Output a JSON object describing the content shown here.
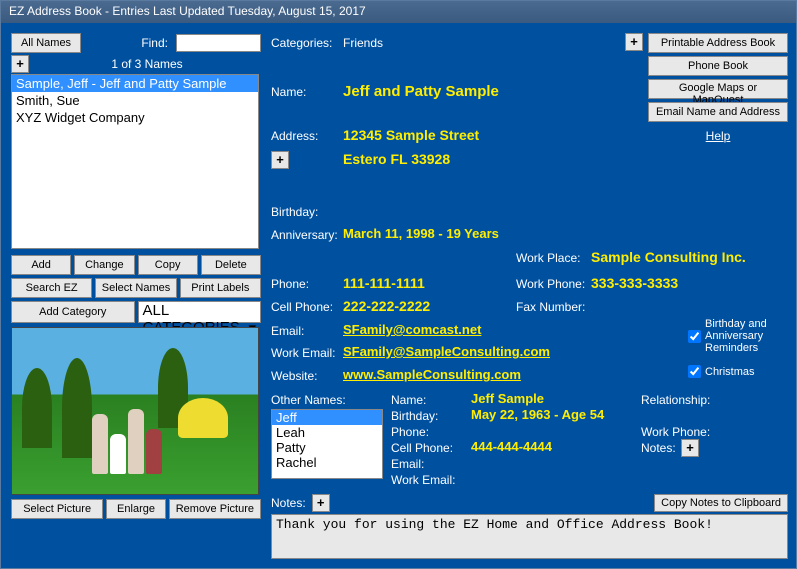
{
  "window": {
    "title": "EZ Address Book - Entries Last Updated Tuesday, August 15, 2017"
  },
  "left": {
    "all_names_btn": "All Names",
    "find_label": "Find:",
    "find_value": "",
    "add_sm": "+",
    "counter": "1 of 3 Names",
    "names": [
      {
        "text": "Sample, Jeff - Jeff and Patty Sample",
        "selected": true
      },
      {
        "text": "Smith, Sue",
        "selected": false
      },
      {
        "text": "XYZ Widget Company",
        "selected": false
      }
    ],
    "btns": {
      "add": "Add",
      "change": "Change",
      "copy": "Copy",
      "delete": "Delete",
      "search": "Search EZ",
      "select": "Select Names",
      "print": "Print Labels",
      "addcat": "Add Category"
    },
    "cat_select": "ALL CATEGORIES",
    "pic_btns": {
      "select": "Select Picture",
      "enlarge": "Enlarge",
      "remove": "Remove Picture"
    }
  },
  "side": {
    "plus": "+",
    "printable": "Printable Address Book",
    "phone": "Phone Book",
    "maps": "Google Maps or MapQuest",
    "email": "Email Name and Address",
    "help": "Help"
  },
  "detail": {
    "categories_lbl": "Categories:",
    "categories_val": "Friends",
    "name_lbl": "Name:",
    "name_val": "Jeff and Patty Sample",
    "address_lbl": "Address:",
    "address_plus": "+",
    "addr1": "12345 Sample Street",
    "addr2": "Estero FL  33928",
    "birthday_lbl": "Birthday:",
    "anniv_lbl": "Anniversary:",
    "anniv_val": "March 11, 1998   -   19 Years",
    "phone_lbl": "Phone:",
    "phone_val": "111-111-1111",
    "cell_lbl": "Cell Phone:",
    "cell_val": "222-222-2222",
    "email_lbl": "Email:",
    "email_val": "SFamily@comcast.net",
    "wemail_lbl": "Work Email:",
    "wemail_val": "SFamily@SampleConsulting.com",
    "website_lbl": "Website:",
    "website_val": "www.SampleConsulting.com",
    "workplace_lbl": "Work Place:",
    "workplace_val": "Sample Consulting Inc.",
    "workphone_lbl": "Work Phone:",
    "workphone_val": "333-333-3333",
    "fax_lbl": "Fax Number:",
    "chk1": "Birthday and Anniversary Reminders",
    "chk2": "Christmas"
  },
  "other": {
    "header": "Other Names:",
    "names": [
      {
        "text": "Jeff",
        "selected": true
      },
      {
        "text": "Leah",
        "selected": false
      },
      {
        "text": "Patty",
        "selected": false
      },
      {
        "text": "Rachel",
        "selected": false
      }
    ],
    "name_lbl": "Name:",
    "name_val": "Jeff Sample",
    "bday_lbl": "Birthday:",
    "bday_val": "May 22, 1963 - Age 54",
    "phone_lbl": "Phone:",
    "cell_lbl": "Cell Phone:",
    "cell_val": "444-444-4444",
    "email_lbl": "Email:",
    "wemail_lbl": "Work Email:",
    "rel_lbl": "Relationship:",
    "wphone_lbl": "Work Phone:",
    "notes_lbl": "Notes:",
    "notes_plus": "+"
  },
  "notes": {
    "lbl": "Notes:",
    "plus": "+",
    "copy_btn": "Copy Notes to Clipboard",
    "text": "Thank you for using the EZ Home and Office Address Book!"
  }
}
